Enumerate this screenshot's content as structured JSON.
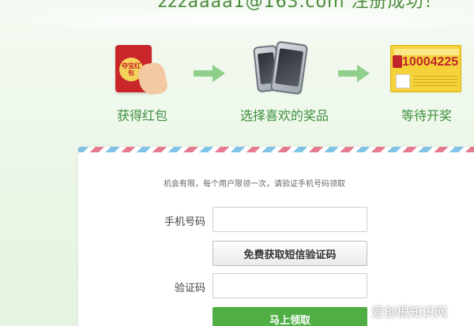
{
  "header": {
    "success_message": "zzzaaaa1@163.com 注册成功！"
  },
  "steps": [
    {
      "label": "获得红包",
      "icon": "red-envelope-icon",
      "seal_text": "夺宝红包"
    },
    {
      "label": "选择喜欢的奖品",
      "icon": "smartphones-icon"
    },
    {
      "label": "等待开奖",
      "icon": "lottery-ticket-icon",
      "ticket_number": "10004225"
    }
  ],
  "form": {
    "notice": "机会有限，每个用户限领一次，请验证手机号码领取",
    "phone_label": "手机号码",
    "phone_value": "",
    "sms_button_label": "免费获取短信验证码",
    "code_label": "验证码",
    "code_value": "",
    "submit_label": "马上领取"
  },
  "watermark": {
    "text": "爱创根知识网"
  },
  "colors": {
    "accent_green": "#4faf44",
    "step_label_green": "#3e8f3e",
    "envelope_red": "#c9262b",
    "ticket_yellow": "#f6d23a"
  }
}
